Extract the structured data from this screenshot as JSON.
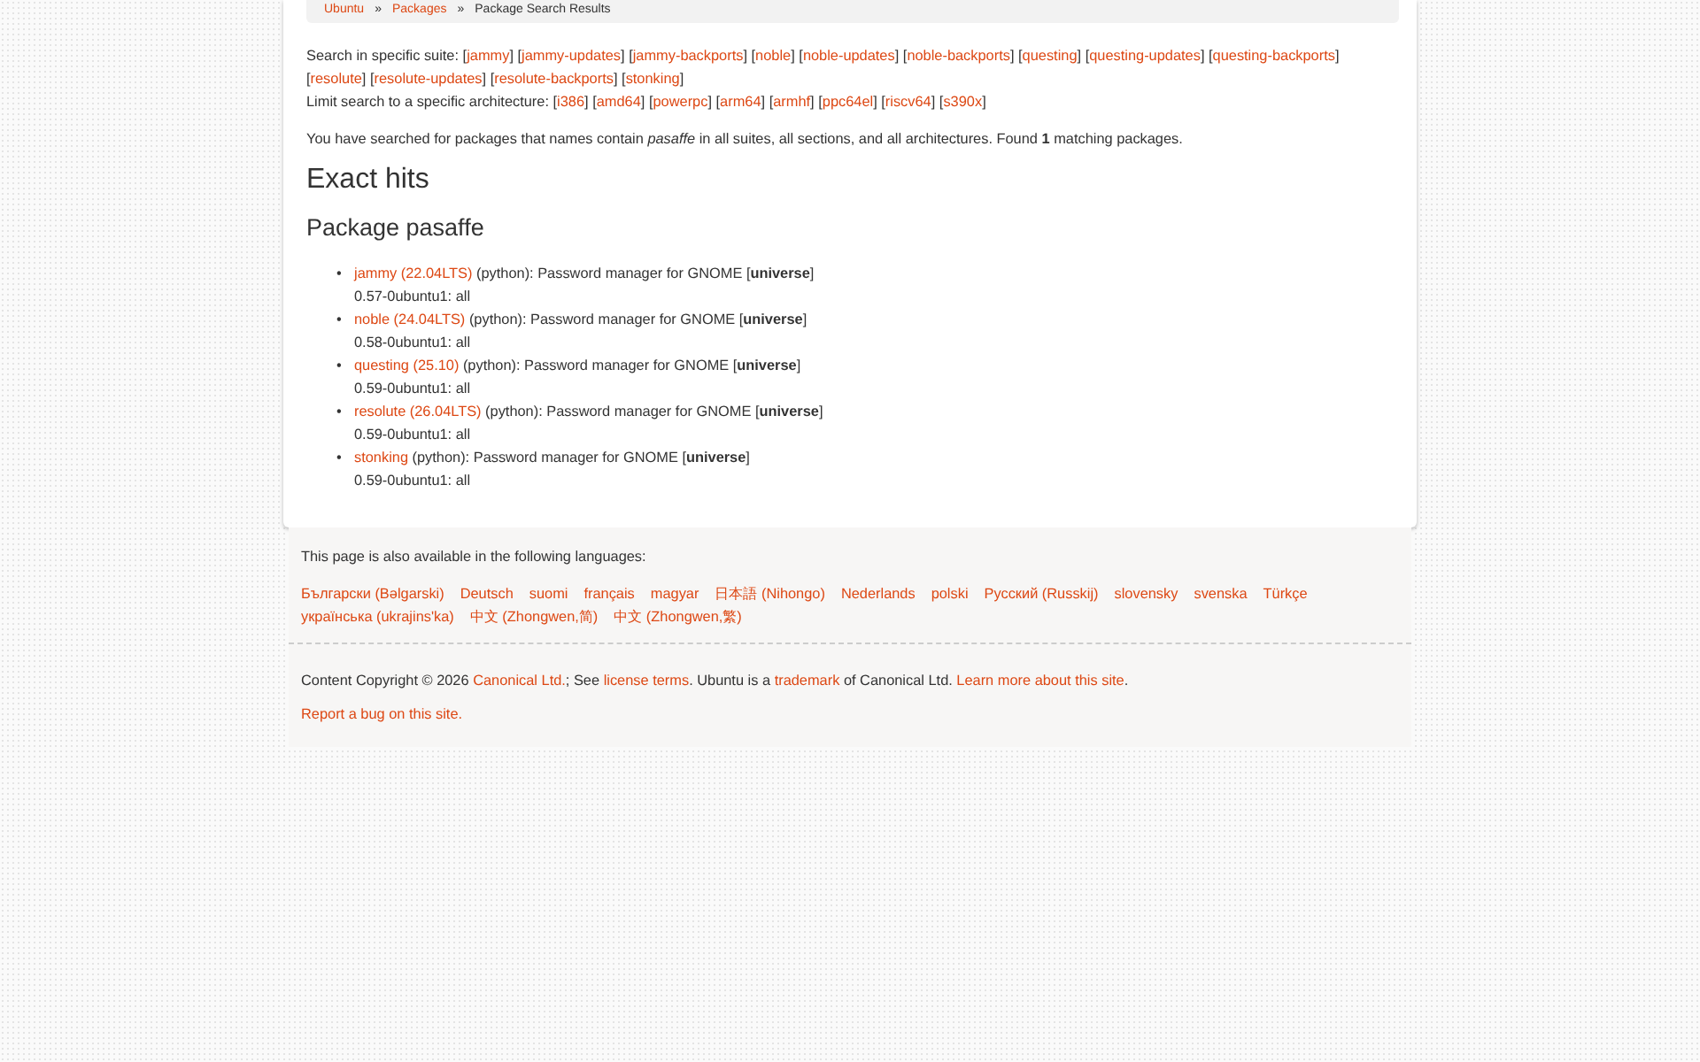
{
  "breadcrumb": {
    "items": [
      "Ubuntu",
      "Packages"
    ],
    "current": "Package Search Results",
    "separator": "»"
  },
  "bracket_open": "[",
  "bracket_close": "]",
  "bullet": "•",
  "suite_filter": {
    "label": "Search in specific suite:",
    "options": [
      "jammy",
      "jammy-updates",
      "jammy-backports",
      "noble",
      "noble-updates",
      "noble-backports",
      "questing",
      "questing-updates",
      "questing-backports",
      "resolute",
      "resolute-updates",
      "resolute-backports",
      "stonking"
    ]
  },
  "arch_filter": {
    "label": "Limit search to a specific architecture:",
    "options": [
      "i386",
      "amd64",
      "powerpc",
      "arm64",
      "armhf",
      "ppc64el",
      "riscv64",
      "s390x"
    ]
  },
  "summary": "You have searched for packages that names contain *pasaffe* in all suites, all sections, and all architectures. Found **1** matching packages.",
  "heading": "Exact hits",
  "package_heading": "Package pasaffe",
  "results": [
    {
      "suite": "jammy (22.04LTS)",
      "details": " (python): Password manager for GNOME [**universe**]",
      "version": "0.57-0ubuntu1: all"
    },
    {
      "suite": "noble (24.04LTS)",
      "details": " (python): Password manager for GNOME [**universe**]",
      "version": "0.58-0ubuntu1: all"
    },
    {
      "suite": "questing (25.10)",
      "details": " (python): Password manager for GNOME [**universe**]",
      "version": "0.59-0ubuntu1: all"
    },
    {
      "suite": "resolute (26.04LTS)",
      "details": " (python): Password manager for GNOME [**universe**]",
      "version": "0.59-0ubuntu1: all"
    },
    {
      "suite": "stonking",
      "details": " (python): Password manager for GNOME [**universe**]",
      "version": "0.59-0ubuntu1: all"
    }
  ],
  "footer": {
    "languages_intro": "This page is also available in the following languages:",
    "languages": [
      "Български (Bəlgarski)",
      "Deutsch",
      "suomi",
      "français",
      "magyar",
      "日本語 (Nihongo)",
      "Nederlands",
      "polski",
      "Русский (Russkij)",
      "slovensky",
      "svenska",
      "Türkçe",
      "українська (ukrajins'ka)",
      "中文 (Zhongwen,简)",
      "中文 (Zhongwen,繁)"
    ],
    "copyright": [
      {
        "kind": "text",
        "text": "Content Copyright © 2026 "
      },
      {
        "kind": "link",
        "text": "Canonical Ltd."
      },
      {
        "kind": "text",
        "text": "; See "
      },
      {
        "kind": "link",
        "text": "license terms"
      },
      {
        "kind": "text",
        "text": ". Ubuntu is a "
      },
      {
        "kind": "link",
        "text": "trademark"
      },
      {
        "kind": "text",
        "text": " of Canonical Ltd. "
      },
      {
        "kind": "link",
        "text": "Learn more about this site"
      },
      {
        "kind": "text",
        "text": "."
      }
    ],
    "report_link": "Report a bug on this site."
  }
}
